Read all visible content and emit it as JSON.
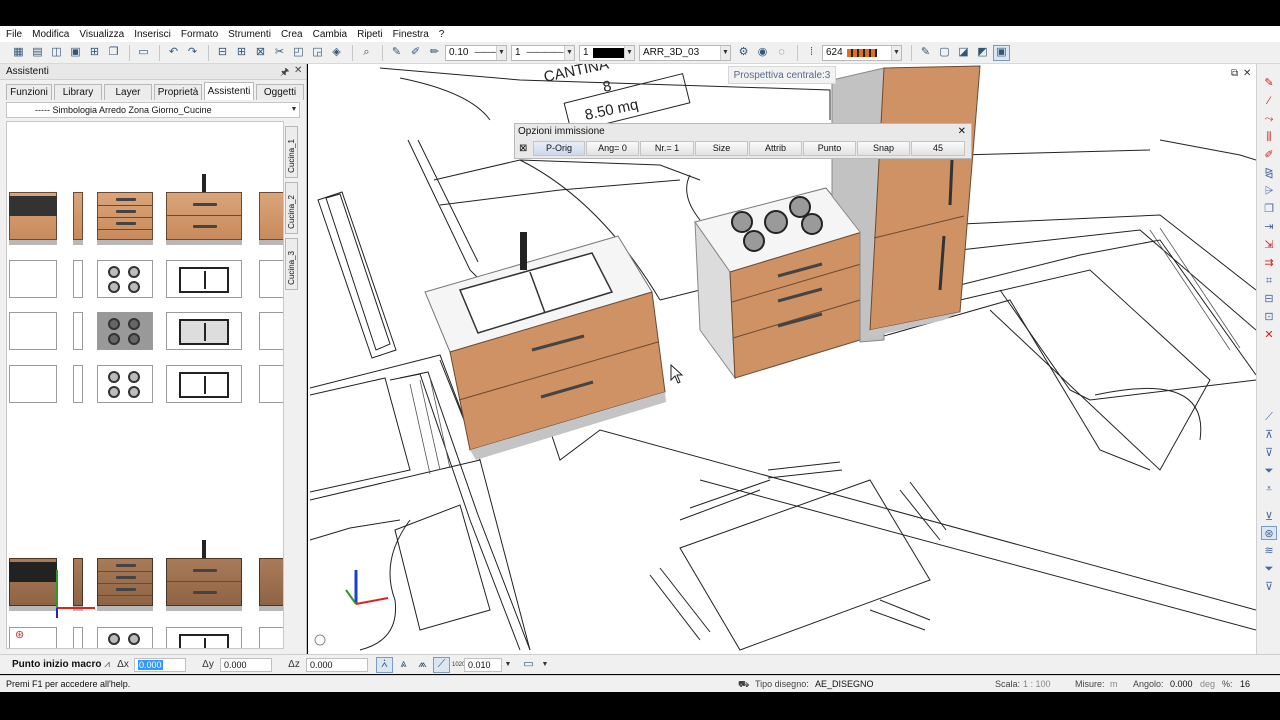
{
  "menu": [
    "File",
    "Modifica",
    "Visualizza",
    "Inserisci",
    "Formato",
    "Strumenti",
    "Crea",
    "Cambia",
    "Ripeti",
    "Finestra",
    "?"
  ],
  "toolbar": {
    "pen_thickness": "0.10",
    "line_type": "1",
    "color_number": "1",
    "layer": "ARR_3D_03",
    "value": "624"
  },
  "perspective_label": "Prospettiva centrale:3",
  "left_panel": {
    "title": "Assistenti",
    "tabs": [
      "Funzioni",
      "Library",
      "Layer",
      "Proprietà",
      "Assistenti",
      "Oggetti"
    ],
    "active_tab": "Assistenti",
    "selector": "----- Simbologia Arredo Zona Giorno_Cucine",
    "vertical_tabs": [
      "Cucina_1",
      "Cucina_2",
      "Cucina_3"
    ]
  },
  "options_panel": {
    "title": "Opzioni immissione",
    "buttons": [
      "P-Orig",
      "Ang= 0",
      "Nr.= 1",
      "Size",
      "Attrib",
      "Punto",
      "Snap",
      "45"
    ]
  },
  "drawing": {
    "room_name": "CANTINA",
    "room_number": "8",
    "room_area": "8.50 mq"
  },
  "input_bar": {
    "label": "Punto inizio macro",
    "dx_label": "Δx",
    "dx_value": "0.000",
    "dy_label": "Δy",
    "dy_value": "0.000",
    "dz_label": "Δz",
    "dz_value": "0.000",
    "step_label": "1020",
    "step_value": "0.010"
  },
  "status_bar": {
    "hint": "Premi F1 per accedere all'help.",
    "drawing_type_label": "Tipo disegno:",
    "drawing_type": "AE_DISEGNO",
    "scale_label": "Scala:",
    "scale": "1 : 100",
    "measure_label": "Misure:",
    "measure": "m",
    "angle_label": "Angolo:",
    "angle": "0.000",
    "angle_unit": "deg",
    "percent_label": "%:",
    "percent": "16"
  },
  "colors": {
    "wood": "#c98a5c",
    "panel": "#f0f0f0",
    "accent_text": "#5a6b88"
  }
}
